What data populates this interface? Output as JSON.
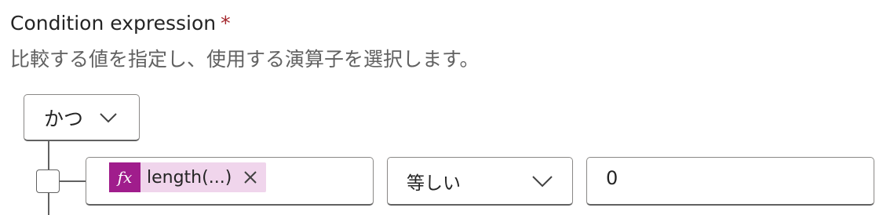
{
  "condition": {
    "label": "Condition expression",
    "required_marker": "*",
    "description": "比較する値を指定し、使用する演算子を選択します。"
  },
  "group": {
    "operator": "かつ"
  },
  "row": {
    "left_token": {
      "icon": "fx",
      "text": "length(...)"
    },
    "operator": "等しい",
    "right_value": "0"
  },
  "colors": {
    "token_icon_bg": "#a01d8c",
    "token_bg": "#f0d5ec",
    "required": "#a4262c"
  }
}
